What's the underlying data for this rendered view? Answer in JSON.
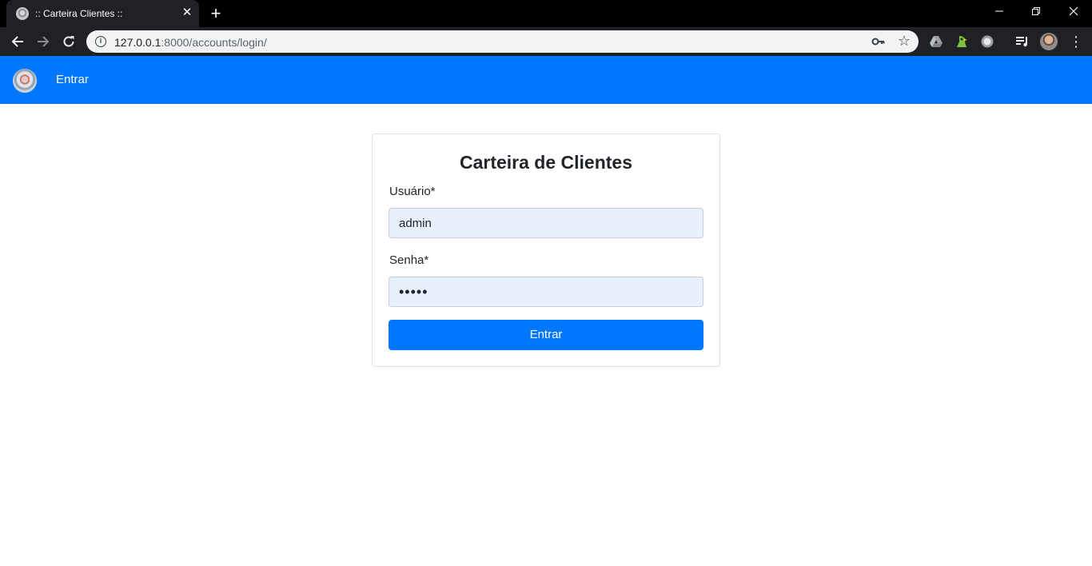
{
  "browser": {
    "tab_title": ":: Carteira Clientes ::",
    "tab_close_glyph": "✕",
    "new_tab_glyph": "+",
    "url_host": "127.0.0.1",
    "url_path": ":8000/accounts/login/",
    "info_glyph": "i",
    "star_glyph": "☆",
    "menu_glyph": "⋮",
    "back_glyph": "←",
    "forward_glyph": "→",
    "reload_glyph": "↻",
    "minimize_glyph": "—",
    "restore_glyph": "❐",
    "close_glyph": "✕"
  },
  "navbar": {
    "color": "#0077ff",
    "link_label": "Entrar"
  },
  "login": {
    "title": "Carteira de Clientes",
    "username_label": "Usuário*",
    "username_value": "admin",
    "password_label": "Senha*",
    "password_value": "•••••",
    "submit_label": "Entrar"
  }
}
